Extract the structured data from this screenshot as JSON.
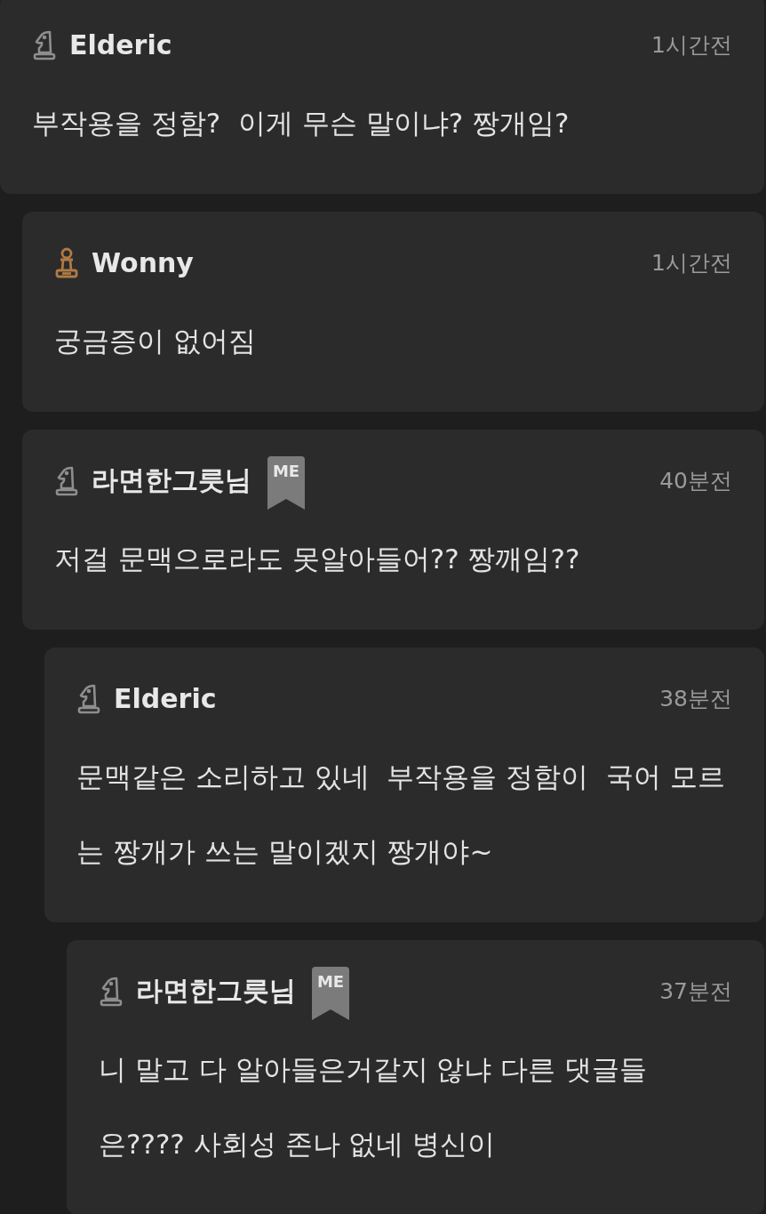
{
  "comments": [
    {
      "author": "Elderic",
      "kind": "knight",
      "time": "1시간전",
      "text": "부작용을 정함?  이게 무슨 말이냐? 짱개임?",
      "children": [
        {
          "author": "Wonny",
          "kind": "pawn",
          "time": "1시간전",
          "text": "궁금증이 없어짐"
        },
        {
          "author": "라면한그릇님",
          "kind": "knight",
          "badge": "ME",
          "time": "40분전",
          "text": "저걸 문맥으로라도 못알아들어?? 짱깨임??",
          "children": [
            {
              "author": "Elderic",
              "kind": "knight",
              "time": "38분전",
              "text": "문맥같은 소리하고 있네  부작용을 정함이  국어 모르는 짱개가 쓰는 말이겠지 짱개야~",
              "children": [
                {
                  "author": "라면한그릇님",
                  "kind": "knight",
                  "badge": "ME",
                  "time": "37분전",
                  "text": "니 말고 다 알아들은거같지 않냐 다른 댓글들은???? 사회성 존나 없네 병신이"
                }
              ]
            }
          ]
        }
      ]
    }
  ]
}
